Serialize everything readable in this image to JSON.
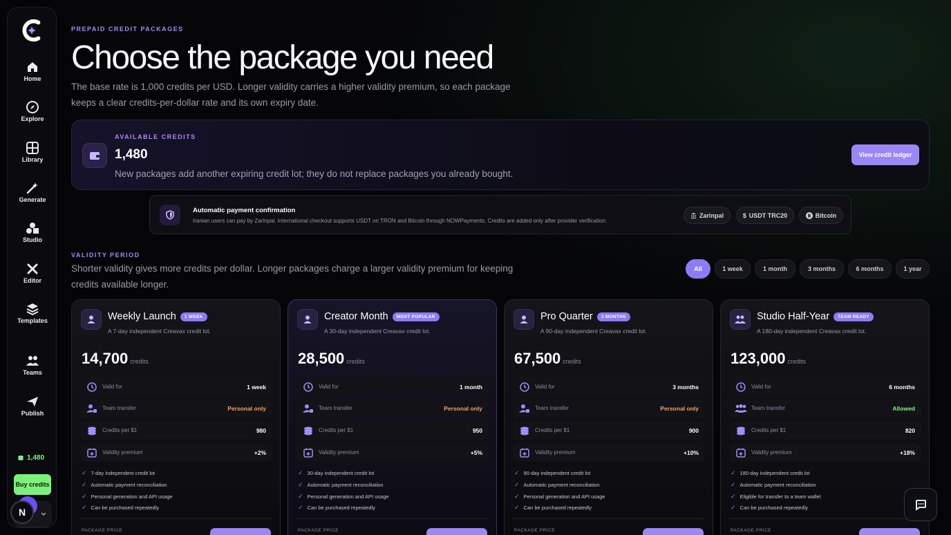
{
  "sidebar": {
    "items": [
      {
        "label": "Home",
        "icon": "home-icon"
      },
      {
        "label": "Explore",
        "icon": "compass-icon"
      },
      {
        "label": "Library",
        "icon": "grid-icon"
      },
      {
        "label": "Generate",
        "icon": "wand-icon"
      },
      {
        "label": "Studio",
        "icon": "shapes-icon"
      },
      {
        "label": "Editor",
        "icon": "tools-icon"
      },
      {
        "label": "Templates",
        "icon": "layers-icon"
      },
      {
        "label": "Teams",
        "icon": "users-icon"
      },
      {
        "label": "Publish",
        "icon": "send-icon"
      }
    ],
    "credits": "1,480",
    "buy_label": "Buy credits",
    "avatar_initial": "N"
  },
  "header": {
    "eyebrow": "PREPAID CREDIT PACKAGES",
    "title": "Choose the package you need",
    "lede": "The base rate is 1,000 credits per USD. Longer validity carries a higher validity premium, so each package keeps a clear credits-per-dollar rate and its own expiry date."
  },
  "credits_card": {
    "eyebrow": "AVAILABLE CREDITS",
    "amount": "1,480",
    "note": "New packages add another expiring credit lot; they do not replace packages you already bought.",
    "ledger_button": "View credit ledger"
  },
  "payment": {
    "title": "Automatic payment confirmation",
    "text": "Iranian users can pay by Zarinpal. International checkout supports USDT on TRON and Bitcoin through NOWPayments. Credits are added only after provider verification.",
    "methods": [
      "Zarinpal",
      "USDT TRC20",
      "Bitcoin"
    ]
  },
  "validity": {
    "eyebrow": "VALIDITY PERIOD",
    "text": "Shorter validity gives more credits per dollar. Longer packages charge a larger validity premium for keeping credits available longer.",
    "filters": [
      "All",
      "1 week",
      "1 month",
      "3 months",
      "6 months",
      "1 year"
    ],
    "active_filter": "All"
  },
  "row_labels": {
    "valid_for": "Valid for",
    "team_transfer": "Team transfer",
    "credits_per": "Credits per $1",
    "premium": "Validity premium",
    "credits_unit": "credits",
    "price_label": "PACKAGE PRICE"
  },
  "packages": [
    {
      "name": "Weekly Launch",
      "badge": "1 WEEK",
      "sub": "A 7-day independent Creavax credit lot.",
      "amount": "14,700",
      "valid_for": "1 week",
      "transfer": "Personal only",
      "per_dollar": "980",
      "premium": "+2%",
      "features": [
        "7-day independent credit lot",
        "Automatic payment reconciliation",
        "Personal generation and API usage",
        "Can be purchased repeatedly"
      ]
    },
    {
      "name": "Creator Month",
      "badge": "MOST POPULAR",
      "sub": "A 30-day independent Creavax credit lot.",
      "amount": "28,500",
      "valid_for": "1 month",
      "transfer": "Personal only",
      "per_dollar": "950",
      "premium": "+5%",
      "features": [
        "30-day independent credit lot",
        "Automatic payment reconciliation",
        "Personal generation and API usage",
        "Can be purchased repeatedly"
      ]
    },
    {
      "name": "Pro Quarter",
      "badge": "3 MONTHS",
      "sub": "A 90-day independent Creavax credit lot.",
      "amount": "67,500",
      "valid_for": "3 months",
      "transfer": "Personal only",
      "per_dollar": "900",
      "premium": "+10%",
      "features": [
        "90-day independent credit lot",
        "Automatic payment reconciliation",
        "Personal generation and API usage",
        "Can be purchased repeatedly"
      ]
    },
    {
      "name": "Studio Half-Year",
      "badge": "TEAM READY",
      "sub": "A 180-day independent Creavax credit lot.",
      "amount": "123,000",
      "valid_for": "6 months",
      "transfer": "Allowed",
      "per_dollar": "820",
      "premium": "+18%",
      "features": [
        "180-day independent credit lot",
        "Automatic payment reconciliation",
        "Eligible for transfer to a team wallet",
        "Can be purchased repeatedly"
      ]
    }
  ],
  "colors": {
    "accent": "#8b7cf6",
    "green": "#7df08a",
    "orange": "#f5a062"
  }
}
